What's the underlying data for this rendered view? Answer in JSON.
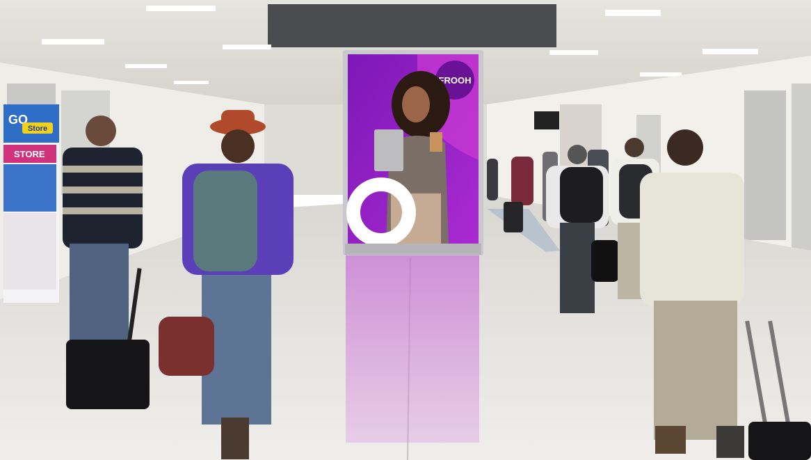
{
  "scene": {
    "description_kind": "photo",
    "colors": {
      "floor": "#e4e2de",
      "ceiling": "#ecebe7",
      "wall": "#f1efea",
      "ad_purple": "#8a1fc2",
      "ad_magenta": "#c13ccf",
      "ad_frame": "#c9c9cc"
    }
  },
  "billboard": {
    "brand_label": "FROOH"
  },
  "kiosk": {
    "logo_text": "GO",
    "store_label": "Store",
    "store_banner": "STORE"
  }
}
